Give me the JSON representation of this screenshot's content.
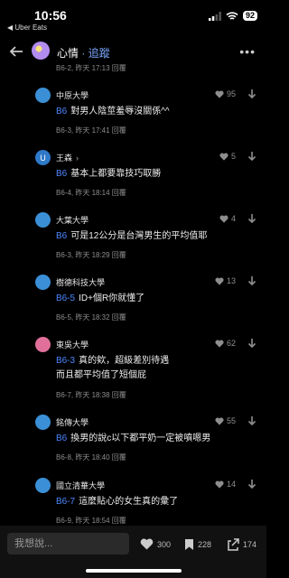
{
  "status": {
    "time": "10:56",
    "back_app": "◀ Uber Eats",
    "battery": "92"
  },
  "header": {
    "board": "心情",
    "separator": " · ",
    "follow": "追蹤"
  },
  "cut_meta": "B6-2, 昨天 17:13  回覆",
  "comments": [
    {
      "school": "中原大學",
      "floor": "B6",
      "text": "對男人陰莖羞辱沒關係^^",
      "text2": "",
      "meta": "B6-3, 昨天 17:41  回覆",
      "likes": "95",
      "avatar_color": "#3b8fd6",
      "avatar_letter": ""
    },
    {
      "school": "王森",
      "floor": "B6",
      "text": "基本上都要靠技巧取勝",
      "text2": "",
      "meta": "B6-4, 昨天 18:14  回覆",
      "likes": "5",
      "avatar_color": "#2f79c9",
      "avatar_letter": "U"
    },
    {
      "school": "大葉大學",
      "floor": "B6",
      "text": "可是12公分是台灣男生的平均值耶",
      "text2": "",
      "meta": "B6-3, 昨天 18:29  回覆",
      "likes": "4",
      "avatar_color": "#3b8fd6",
      "avatar_letter": ""
    },
    {
      "school": "樹德科技大學",
      "floor": "B6-5",
      "text": "ID+個R你就懂了",
      "text2": "",
      "meta": "B6-5, 昨天 18:32  回覆",
      "likes": "13",
      "avatar_color": "#3b8fd6",
      "avatar_letter": ""
    },
    {
      "school": "東吳大學",
      "floor": "B6-3",
      "text": "真的欸，超級差別待遇",
      "text2": "而且都平均值了短個屁",
      "meta": "B6-7, 昨天 18:38  回覆",
      "likes": "62",
      "avatar_color": "#e0709a",
      "avatar_letter": ""
    },
    {
      "school": "銘傳大學",
      "floor": "B6",
      "text": "換男的說c以下都平奶一定被噴嗯男",
      "text2": "",
      "meta": "B6-8, 昨天 18:40  回覆",
      "likes": "55",
      "avatar_color": "#3b8fd6",
      "avatar_letter": ""
    },
    {
      "school": "國立清華大學",
      "floor": "B6-7",
      "text": "這麼貼心的女生真的彙了",
      "text2": "",
      "meta": "B6-9, 昨天 18:54  回覆",
      "likes": "14",
      "avatar_color": "#3b8fd6",
      "avatar_letter": ""
    }
  ],
  "bottom": {
    "placeholder": "我想說...",
    "likes": "300",
    "bookmarks": "228",
    "shares": "174"
  }
}
